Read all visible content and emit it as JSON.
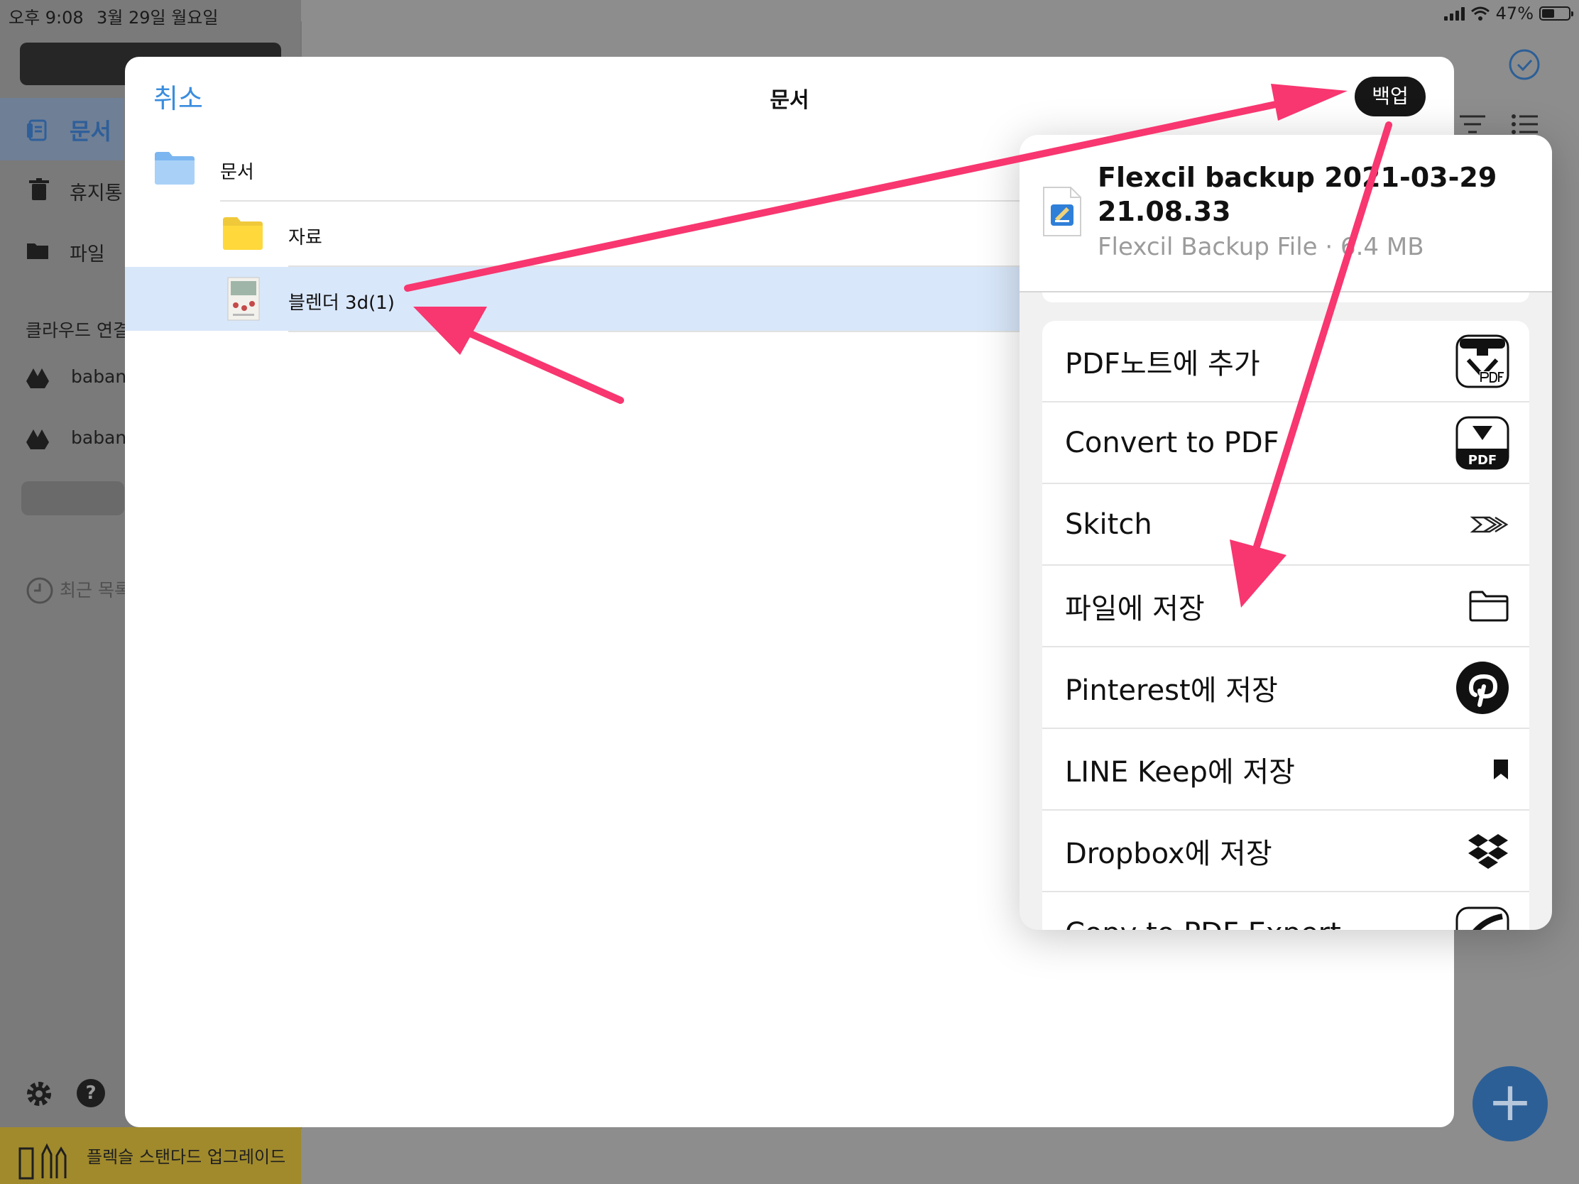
{
  "status_bar": {
    "time": "오후 9:08",
    "date": "3월 29일 월요일",
    "battery": "47%"
  },
  "sidebar": {
    "items": [
      {
        "label": "문서"
      },
      {
        "label": "휴지통"
      },
      {
        "label": "파일"
      }
    ],
    "cloud_section": "클라우드 연결",
    "cloud_accounts": [
      {
        "label": "baban"
      },
      {
        "label": "baban"
      }
    ],
    "recent": "최근 목록",
    "help_icon": "?",
    "upgrade": "플렉슬 스탠다드 업그레이드"
  },
  "fab": {
    "label": "+"
  },
  "picker": {
    "cancel": "취소",
    "title": "문서",
    "backup_button": "백업",
    "root_folder": "문서",
    "items": [
      {
        "label": "자료",
        "type": "folder"
      },
      {
        "label": "블렌더 3d(1)",
        "type": "document",
        "selected": true
      }
    ]
  },
  "share_sheet": {
    "file_name": "Flexcil backup 2021-03-29 21.08.33",
    "file_meta": "Flexcil Backup File · 6.4 MB",
    "actions": [
      {
        "label": "PDF노트에 추가",
        "icon": "pdf-notes-icon"
      },
      {
        "label": "Convert to PDF",
        "icon": "convert-pdf-icon"
      },
      {
        "label": "Skitch",
        "icon": "skitch-icon"
      },
      {
        "label": "파일에 저장",
        "icon": "folder-icon"
      },
      {
        "label": "Pinterest에 저장",
        "icon": "pinterest-icon"
      },
      {
        "label": "LINE Keep에 저장",
        "icon": "bookmark-icon"
      },
      {
        "label": "Dropbox에 저장",
        "icon": "dropbox-icon"
      },
      {
        "label": "Copy to PDF Expert",
        "icon": "pdf-expert-icon"
      }
    ]
  },
  "colors": {
    "accent": "#3a8dde",
    "annotation": "#f8366f",
    "selection": "#d9e7fa"
  }
}
